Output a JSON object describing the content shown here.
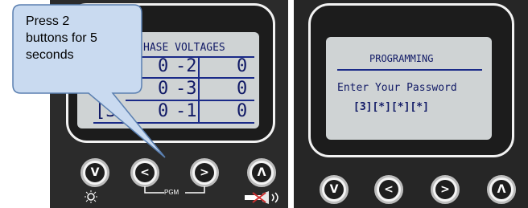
{
  "callout": {
    "text_line1": "Press 2",
    "text_line2": "buttons for 5",
    "text_line3": "seconds"
  },
  "left_display": {
    "title": "HASE VOLTAGES",
    "rows": [
      {
        "prefix": "",
        "value": "0",
        "sep": "-2",
        "reading": "0"
      },
      {
        "prefix": "",
        "value": "0",
        "sep": "-3",
        "reading": "0"
      },
      {
        "prefix": "[3",
        "value": "0",
        "sep": "-1",
        "reading": "0"
      }
    ]
  },
  "left_buttons": {
    "down": "V",
    "left": "<",
    "right": ">",
    "up": "Λ",
    "pgm_label": "PGM"
  },
  "right_display": {
    "title": "PROGRAMMING",
    "prompt": "Enter Your Password",
    "password": "[3][*][*][*]"
  },
  "right_buttons": {
    "down": "V",
    "left": "<",
    "right": ">",
    "up": "Λ"
  },
  "colors": {
    "panel": "#2b2b2b",
    "lcd_background": "#cfd3d4",
    "lcd_text": "#111a66",
    "callout_fill": "#c9daf0",
    "callout_border": "#5a7fb0"
  }
}
